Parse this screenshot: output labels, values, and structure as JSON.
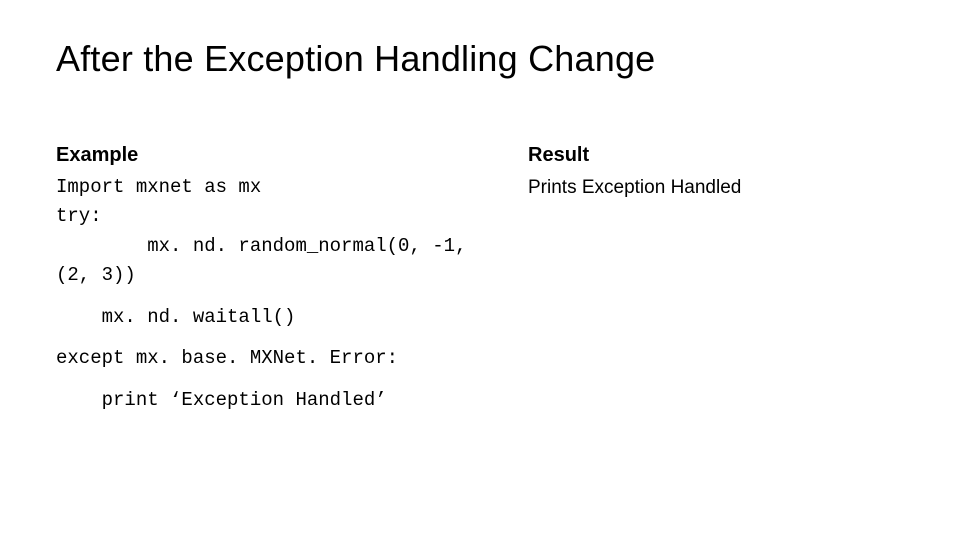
{
  "title": "After the Exception Handling Change",
  "left": {
    "heading": "Example",
    "lines": [
      "Import mxnet as mx",
      "try:",
      "        mx. nd. random_normal(0, -1, (2, 3))",
      "    mx. nd. waitall()",
      "except mx. base. MXNet. Error:",
      "    print ‘Exception Handled’"
    ]
  },
  "right": {
    "heading": "Result",
    "line": "Prints Exception Handled"
  }
}
